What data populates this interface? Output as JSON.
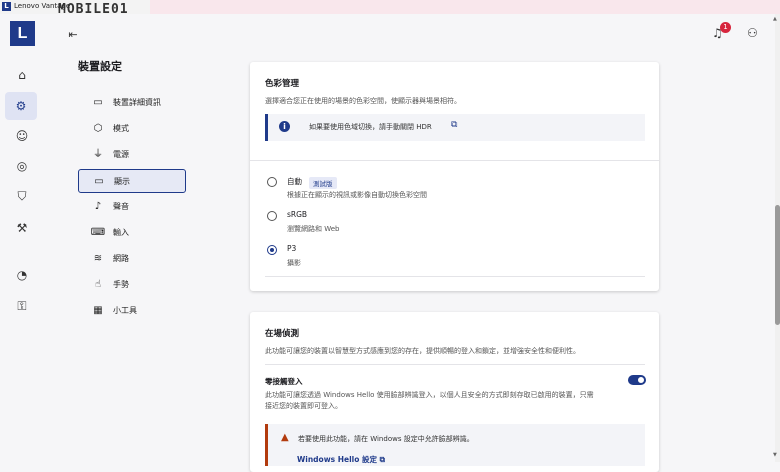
{
  "window": {
    "app_icon": "L",
    "title": "Lenovo Vantage"
  },
  "watermark": {
    "text": "MOBILE01"
  },
  "rail": {
    "logo": "L",
    "collapse_icon": "collapse-menu-icon",
    "items": [
      {
        "name": "home-icon",
        "glyph": "⌂"
      },
      {
        "name": "gear-icon",
        "glyph": "⚙",
        "active": true
      },
      {
        "name": "account-icon",
        "glyph": "☺"
      },
      {
        "name": "radar-icon",
        "glyph": "◎"
      },
      {
        "name": "shield-icon",
        "glyph": "⛉"
      },
      {
        "name": "toolbox-icon",
        "glyph": "⚒"
      },
      {
        "name": "speedometer-icon",
        "glyph": "◔"
      },
      {
        "name": "lock-icon",
        "glyph": "🔒"
      }
    ]
  },
  "header": {
    "notification_count": "1",
    "bell_glyph": "🔔",
    "user_glyph": "👤"
  },
  "page_title": "裝置設定",
  "settings_menu": [
    {
      "label": "裝置詳細資訊",
      "icon": "laptop-icon",
      "glyph": "▭"
    },
    {
      "label": "模式",
      "icon": "mode-icon",
      "glyph": "⬡"
    },
    {
      "label": "電源",
      "icon": "power-plug-icon",
      "glyph": "⏻"
    },
    {
      "label": "顯示",
      "icon": "display-icon",
      "glyph": "▭",
      "active": true
    },
    {
      "label": "聲音",
      "icon": "music-note-icon",
      "glyph": "♪"
    },
    {
      "label": "輸入",
      "icon": "keyboard-icon",
      "glyph": "⌨"
    },
    {
      "label": "網路",
      "icon": "wifi-icon",
      "glyph": "≋"
    },
    {
      "label": "手勢",
      "icon": "gesture-icon",
      "glyph": "☝"
    },
    {
      "label": "小工具",
      "icon": "widgets-icon",
      "glyph": "▦"
    }
  ],
  "color_management": {
    "title": "色彩管理",
    "description": "選擇適合您正在使用的場景的色彩空間，使顯示器與場景相符。",
    "info_text": "如果要使用色域切換，請手動關閉 HDR",
    "options": [
      {
        "label": "自動",
        "badge": "測試版",
        "description": "根據正在顯示的視訊或影像自動切換色彩空間",
        "checked": false
      },
      {
        "label": "sRGB",
        "description": "瀏覽網路和 Web",
        "checked": false
      },
      {
        "label": "P3",
        "description": "攝影",
        "checked": true
      }
    ]
  },
  "presence_detection": {
    "title": "在場偵測",
    "description": "此功能可讓您的裝置以智慧型方式感應到您的存在，提供順暢的登入和鎖定，並增強安全性和便利性。",
    "zero_touch": {
      "label": "零接觸登入",
      "description_line1": "此功能可讓您透過 Windows Hello 使用臉部辨識登入，以個人且安全的方式即刻存取已啟用的裝置，只需",
      "description_line2": "接近您的裝置即可登入。",
      "enabled": true
    },
    "warning_text": "若要使用此功能，請在 Windows 設定中允許臉部辨識。",
    "warning_link": "Windows Hello 設定"
  }
}
